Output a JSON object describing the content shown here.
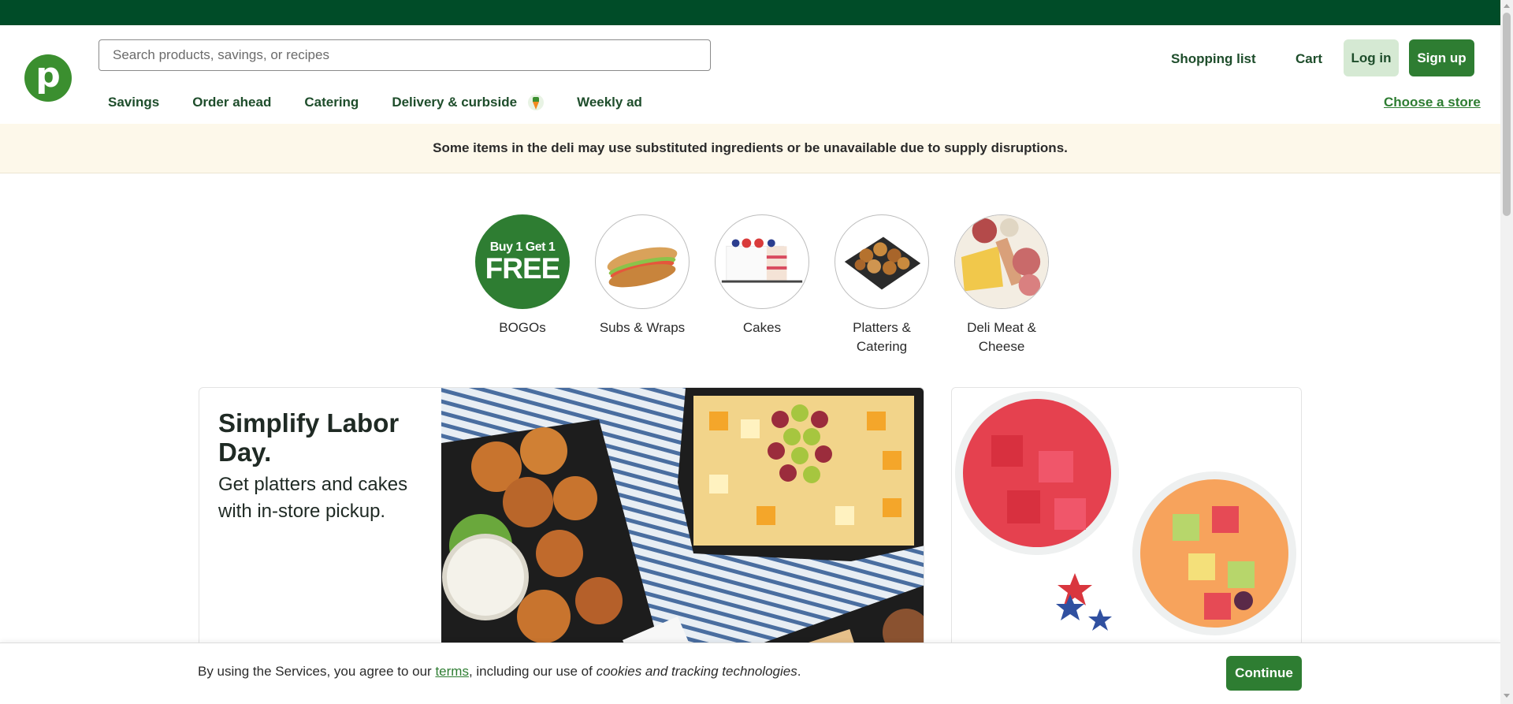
{
  "header": {
    "logo_letter": "p",
    "search_placeholder": "Search products, savings, or recipes",
    "shopping_list": "Shopping list",
    "cart": "Cart",
    "login": "Log in",
    "signup": "Sign up",
    "choose_store": "Choose a store",
    "nav": [
      "Savings",
      "Order ahead",
      "Catering",
      "Delivery & curbside",
      "Weekly ad"
    ]
  },
  "alert": "Some items in the deli may use substituted ingredients or be unavailable due to supply disruptions.",
  "categories": [
    {
      "label": "BOGOs",
      "badge_line1": "Buy 1 Get 1",
      "badge_line2": "FREE"
    },
    {
      "label": "Subs & Wraps"
    },
    {
      "label": "Cakes"
    },
    {
      "label": "Platters & Catering"
    },
    {
      "label": "Deli Meat & Cheese"
    }
  ],
  "promo": {
    "title": "Simplify Labor Day.",
    "subtitle": "Get platters and cakes with in-store pickup."
  },
  "cookie": {
    "prefix": "By using the Services, you agree to our ",
    "terms_link": "terms",
    "middle": ", including our use of ",
    "italic": "cookies and tracking technologies",
    "suffix": ".",
    "continue": "Continue"
  },
  "colors": {
    "brand_dark": "#004c28",
    "brand_green": "#2e7d32",
    "logo_green": "#3b8f2f",
    "alert_bg": "#fdf8ea"
  }
}
